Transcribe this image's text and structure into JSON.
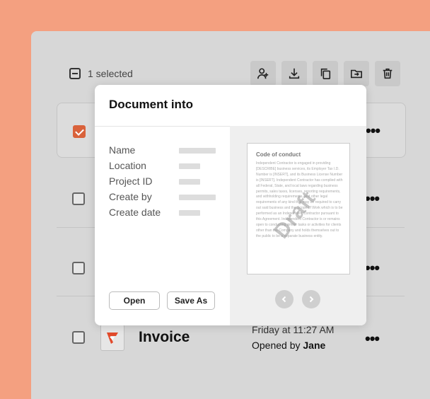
{
  "toolbar": {
    "selection_text": "1 selected",
    "icons": [
      "add-user-icon",
      "download-icon",
      "copy-icon",
      "move-to-folder-icon",
      "trash-icon"
    ]
  },
  "rows": [
    {
      "checked": true
    },
    {
      "checked": false
    },
    {
      "checked": false
    },
    {
      "checked": false,
      "name": "Invoice",
      "time": "Friday at 11:27 AM",
      "opened_by_label": "Opened by",
      "opened_by": "Jane"
    }
  ],
  "modal": {
    "title": "Document into",
    "properties": [
      "Name",
      "Location",
      "Project ID",
      "Create by",
      "Create date"
    ],
    "open_label": "Open",
    "save_as_label": "Save As"
  },
  "preview": {
    "doc_title": "Code of conduct",
    "doc_body": "Independent Contractor is engaged in providing [DESCRIBE] business services, its Employer Tax I.D. Number is [INSERT], and its Business License Number is [INSERT]. Independent Contractor has complied with all Federal, State, and local laws regarding business permits, sales taxes, licenses, reporting requirements, and withholding requirements, and other legal requirements of any kind that may be required to carry out said business and the Scope of Work which is to be performed as an Independent Contractor pursuant to this Agreement. Independent Contractor is or remains open to conducting similar tasks or activities for clients other than the Company and holds themselves out to the public to be a separate business entity.",
    "watermark": "Draft"
  },
  "colors": {
    "accent": "#d9623b",
    "background": "#f4a080"
  }
}
